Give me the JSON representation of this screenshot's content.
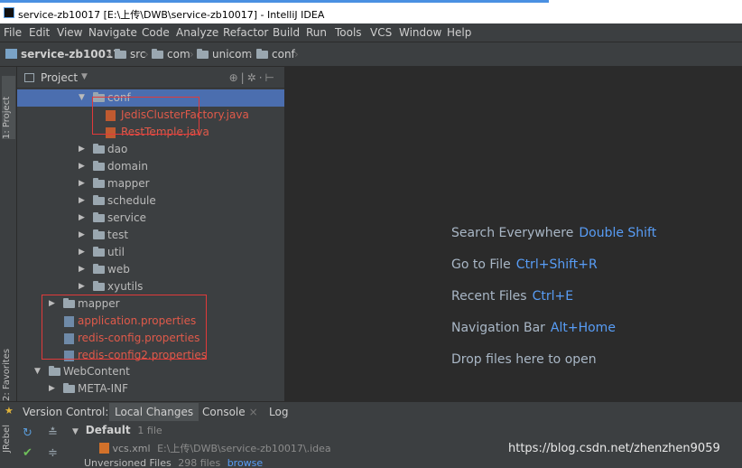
{
  "window": {
    "title": "service-zb10017 [E:\\上传\\DWB\\service-zb10017] - IntelliJ IDEA"
  },
  "menu": [
    "File",
    "Edit",
    "View",
    "Navigate",
    "Code",
    "Analyze",
    "Refactor",
    "Build",
    "Run",
    "Tools",
    "VCS",
    "Window",
    "Help"
  ],
  "breadcrumb": [
    "service-zb10017",
    "src",
    "com",
    "unicom",
    "conf"
  ],
  "left_tabs": {
    "project": "1: Project",
    "favorites": "2: Favorites",
    "rebel": "JRebel"
  },
  "project_panel": {
    "title": "Project",
    "tree": [
      {
        "label": "conf",
        "type": "folder",
        "expanded": true,
        "selected": true
      },
      {
        "label": "JedisClusterFactory.java",
        "type": "java",
        "red": true
      },
      {
        "label": "RestTemple.java",
        "type": "java",
        "red": true
      },
      {
        "label": "dao",
        "type": "folder"
      },
      {
        "label": "domain",
        "type": "folder"
      },
      {
        "label": "mapper",
        "type": "folder"
      },
      {
        "label": "schedule",
        "type": "folder"
      },
      {
        "label": "service",
        "type": "folder"
      },
      {
        "label": "test",
        "type": "folder"
      },
      {
        "label": "util",
        "type": "folder"
      },
      {
        "label": "web",
        "type": "folder"
      },
      {
        "label": "xyutils",
        "type": "folder"
      },
      {
        "label": "mapper",
        "type": "folder"
      },
      {
        "label": "application.properties",
        "type": "properties",
        "red": true
      },
      {
        "label": "redis-config.properties",
        "type": "properties",
        "red": true
      },
      {
        "label": "redis-config2.properties",
        "type": "properties",
        "red": true
      },
      {
        "label": "WebContent",
        "type": "folder",
        "expanded": true
      },
      {
        "label": "META-INF",
        "type": "folder"
      }
    ]
  },
  "editor_hints": [
    {
      "text": "Search Everywhere",
      "key": "Double Shift"
    },
    {
      "text": "Go to File",
      "key": "Ctrl+Shift+R"
    },
    {
      "text": "Recent Files",
      "key": "Ctrl+E"
    },
    {
      "text": "Navigation Bar",
      "key": "Alt+Home"
    },
    {
      "text": "Drop files here to open",
      "key": ""
    }
  ],
  "bottom_tabs": {
    "version_control": "Version Control:",
    "local_changes": "Local Changes",
    "console": "Console",
    "console_close": "×",
    "log": "Log"
  },
  "vcs": {
    "changelist": "Default",
    "changelist_count": "1 file",
    "file_name": "vcs.xml",
    "file_path": "E:\\上传\\DWB\\service-zb10017\\.idea",
    "unversioned": "Unversioned Files",
    "unversioned_count": "298 files",
    "browse": "browse"
  },
  "watermark": "https://blog.csdn.net/zhenzhen9059",
  "colors": {
    "selection": "#4b6eaf",
    "highlight_box": "#e03a3a",
    "shortcut": "#589df6"
  }
}
